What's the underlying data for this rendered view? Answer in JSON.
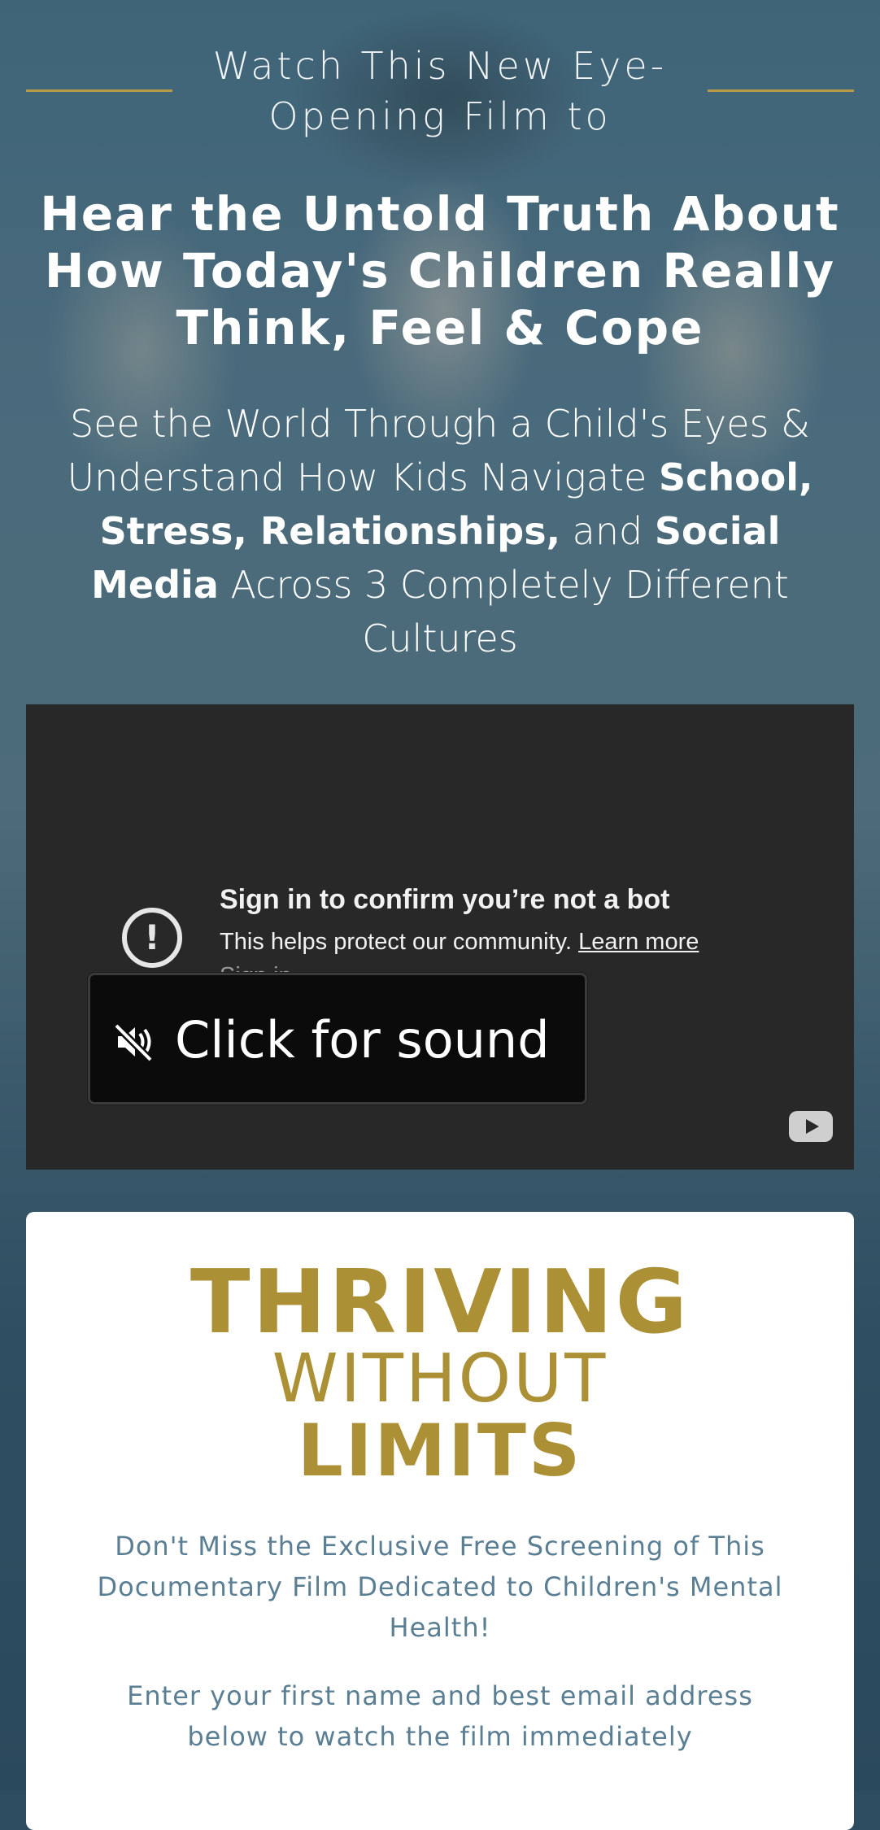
{
  "hero": {
    "kicker": "Watch This New Eye-Opening Film to",
    "headline": "Hear the Untold Truth About How Today's Children Really Think, Feel & Cope",
    "subhead": {
      "part1": "See the World Through a Child's Eyes & Understand How Kids Navigate ",
      "bold1": "School, Stress, Relationships,",
      "part2": " and ",
      "bold2": "Social Media",
      "part3": " Across 3 Completely Different Cultures"
    }
  },
  "video": {
    "alert_title": "Sign in to confirm you’re not a bot",
    "alert_desc": "This helps protect our community. ",
    "learn_more": "Learn more",
    "sign_in": "Sign in",
    "sound_button": "Click for sound",
    "icons": {
      "alert": "alert-circle-icon",
      "muted": "speaker-muted-icon",
      "platform": "youtube-icon"
    }
  },
  "card": {
    "logo": {
      "line1": "THRIVING",
      "line2": "WITHOUT",
      "line3": "LIMITS"
    },
    "promo": "Don't Miss the Exclusive Free Screening of This Documentary Film Dedicated to Children's Mental Health!",
    "instructions": "Enter your first name and best email address below to watch the film immediately"
  },
  "colors": {
    "accent_gold": "#ab9035",
    "kicker_line": "#b69a45",
    "body_blue": "#5a7e93",
    "hero_bg": "#3b5a6c"
  }
}
